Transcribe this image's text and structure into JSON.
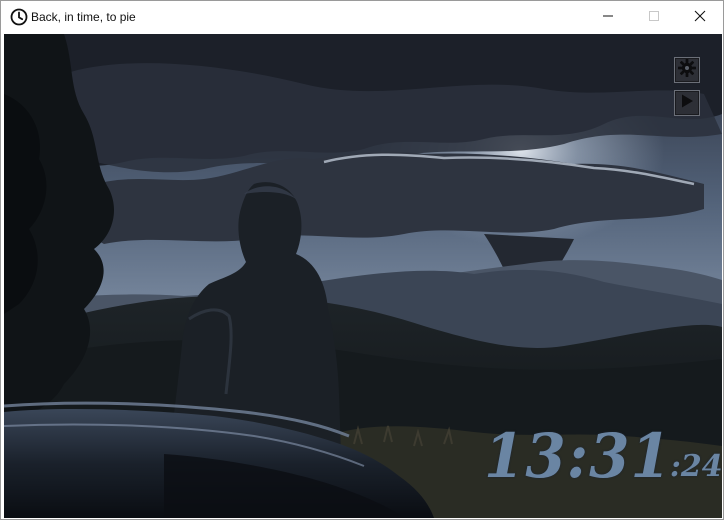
{
  "window": {
    "title": "Back, in time, to pie",
    "controls": {
      "minimize_icon": "minimize-icon",
      "maximize_icon": "maximize-icon",
      "close_icon": "close-icon"
    }
  },
  "app": {
    "icon": "clock-icon",
    "settings_icon": "gear-icon",
    "play_icon": "play-icon"
  },
  "clock": {
    "hours_minutes": "13:31",
    "seconds": ":24",
    "color": "#6a85a3"
  },
  "scene": {
    "description_icon": "background-photo"
  }
}
